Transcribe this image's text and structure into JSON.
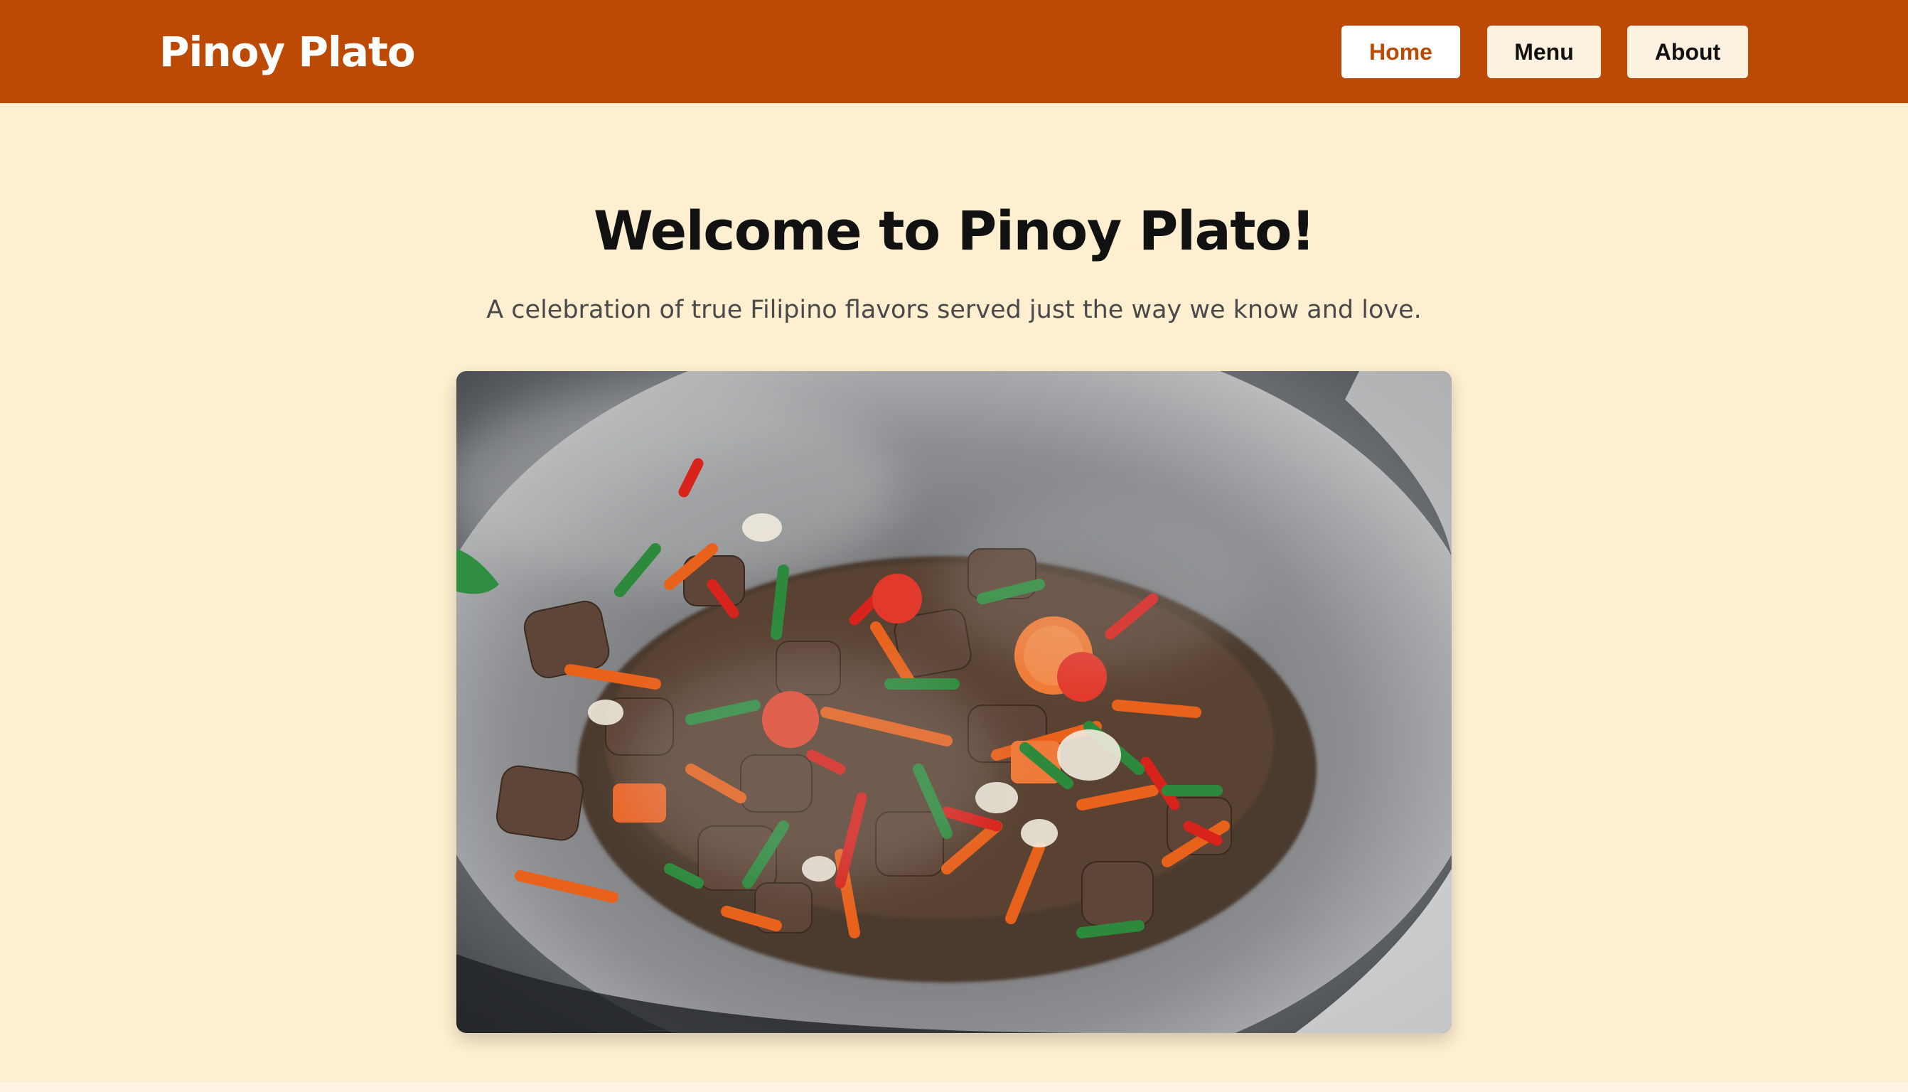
{
  "header": {
    "brand": "Pinoy Plato",
    "nav": [
      {
        "label": "Home",
        "active": true
      },
      {
        "label": "Menu",
        "active": false
      },
      {
        "label": "About",
        "active": false
      }
    ]
  },
  "hero": {
    "title": "Welcome to Pinoy Plato!",
    "subtitle": "A celebration of true Filipino flavors served just the way we know and love."
  },
  "colors": {
    "header_bg": "#bc4a04",
    "page_bg": "#fdefd0",
    "active_nav_text": "#bc4a04"
  }
}
